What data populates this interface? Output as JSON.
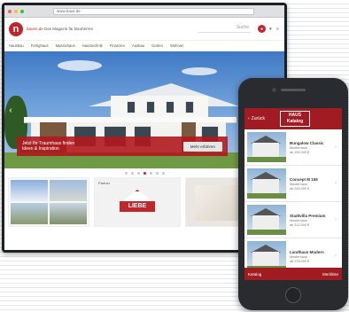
{
  "browser": {
    "url": "www.haus.de",
    "window_controls": [
      "#ff5f57",
      "#febc2e",
      "#28c840"
    ]
  },
  "site": {
    "logo_letter": "n",
    "tagline_part1": "bauen.de",
    "tagline_part2": "Das Magazin für Bauherren",
    "search_placeholder": "Suche",
    "icons": [
      "user-icon",
      "heart-icon",
      "menu-icon"
    ],
    "nav_items": [
      "Hausbau",
      "Fertighaus",
      "Massivhaus",
      "Haustechnik",
      "Finanzen",
      "Ausbau",
      "Garten",
      "Wohnen"
    ],
    "hero": {
      "promo_line1": "Jetzt Ihr Traumhaus finden",
      "promo_line2": "Ideen & Inspiration",
      "button_label": "Mehr erfahren"
    },
    "slider_dot_count": 7,
    "slider_active_index": 3,
    "tile_center_label": "Partner",
    "partner_logo_text": "LIEBE"
  },
  "app": {
    "back_label": "Zurück",
    "logo_line1": "HAUS",
    "logo_line2": "Katalog",
    "items": [
      {
        "title": "Bungalow Classic",
        "sub1": "Musterhaus",
        "sub2": "ab 189.000 €"
      },
      {
        "title": "Concept M 155",
        "sub1": "Musterhaus",
        "sub2": "ab 245.000 €"
      },
      {
        "title": "Stadtvilla Premium",
        "sub1": "Musterhaus",
        "sub2": "ab 312.000 €"
      },
      {
        "title": "Landhaus Modern",
        "sub1": "Musterhaus",
        "sub2": "ab 278.000 €"
      }
    ],
    "footer_left": "Katalog",
    "footer_right": "Merkliste"
  }
}
